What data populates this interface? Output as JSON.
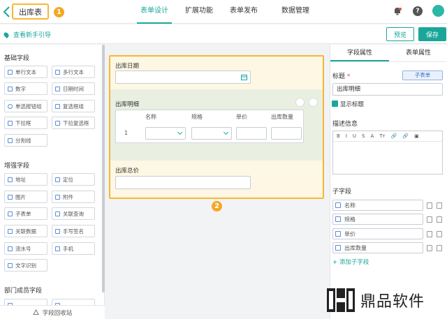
{
  "header": {
    "title": "出库表",
    "badge1": "1",
    "tabs": [
      "表单设计",
      "扩展功能",
      "表单发布",
      "数据管理"
    ],
    "help": "?"
  },
  "guide": {
    "link": "查看新手引导",
    "preview": "预览",
    "save": "保存"
  },
  "left": {
    "basic_title": "基础字段",
    "basic": [
      "单行文本",
      "多行文本",
      "数字",
      "日期时间",
      "单选按钮组",
      "复选框组",
      "下拉框",
      "下拉复选框",
      "分割线"
    ],
    "enhanced_title": "增强字段",
    "enhanced": [
      "地址",
      "定位",
      "图片",
      "附件",
      "子表单",
      "关联查询",
      "关联数据",
      "手写签名",
      "流水号",
      "手机",
      "文字识别"
    ],
    "dept_title": "部门成员字段",
    "recycle": "字段回收站"
  },
  "form": {
    "date_label": "出库日期",
    "detail_label": "出库明细",
    "columns": [
      "名称",
      "规格",
      "单价",
      "出库数量"
    ],
    "row_num": "1",
    "total_label": "出库总价",
    "badge2": "2"
  },
  "right": {
    "tabs": [
      "字段属性",
      "表单属性"
    ],
    "title_label": "标题",
    "required_mark": "*",
    "sub_badge": "子表单",
    "title_value": "出库明细",
    "show_title": "显示标题",
    "desc_label": "描述信息",
    "editor_tools": [
      "B",
      "I",
      "U",
      "S",
      "A",
      "Tт",
      "🔗",
      "🔗",
      "▣"
    ],
    "subfield_label": "子字段",
    "subfields": [
      "名称",
      "规格",
      "单价",
      "出库数量"
    ],
    "add_sub": "+ 添加子字段"
  },
  "watermark": "鼎品软件"
}
